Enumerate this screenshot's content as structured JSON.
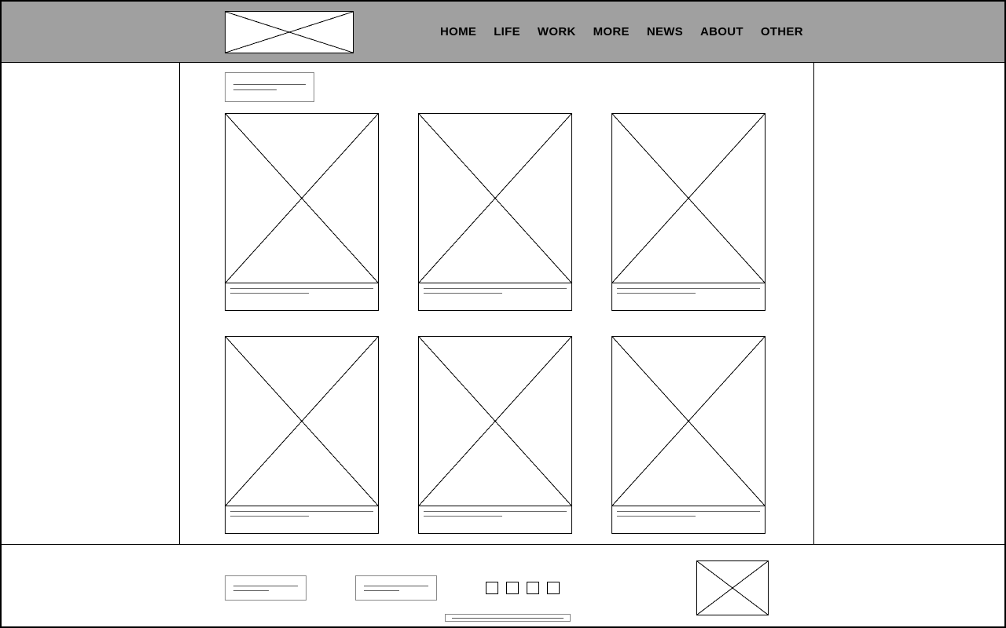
{
  "nav": {
    "items": [
      "HOME",
      "LIFE",
      "WORK",
      "MORE",
      "NEWS",
      "ABOUT",
      "OTHER"
    ]
  }
}
